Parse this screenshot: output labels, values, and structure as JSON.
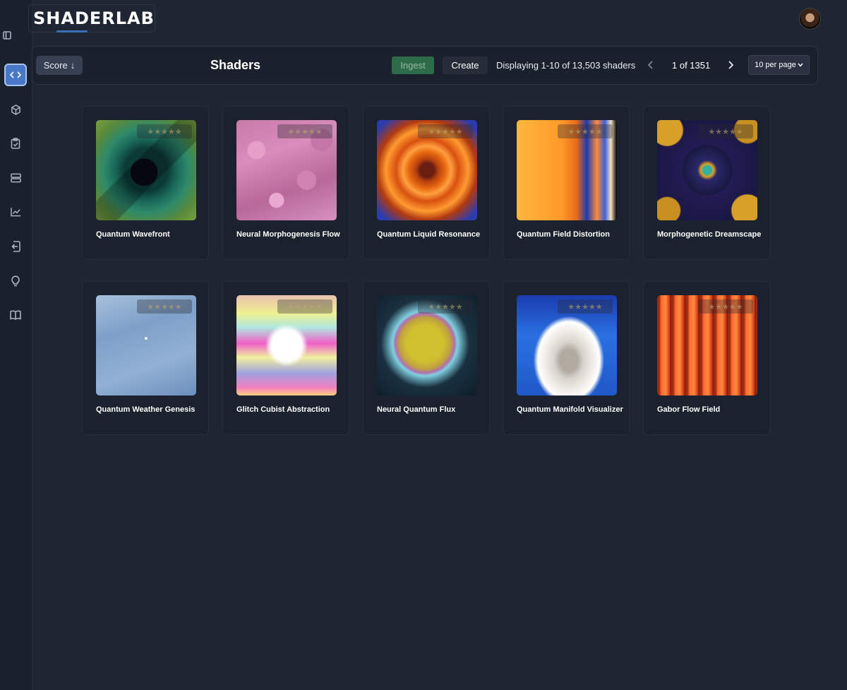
{
  "app": {
    "logo": "SHADERLAB"
  },
  "sidebar": {
    "toggle_icon": "sidebar-toggle-icon",
    "items": [
      {
        "name": "shaders",
        "icon": "code-icon",
        "active": true
      },
      {
        "name": "objects",
        "icon": "cube-icon",
        "active": false
      },
      {
        "name": "tasks",
        "icon": "clipboard-check-icon",
        "active": false
      },
      {
        "name": "storage",
        "icon": "server-icon",
        "active": false
      },
      {
        "name": "analytics",
        "icon": "line-chart-icon",
        "active": false
      },
      {
        "name": "import",
        "icon": "import-icon",
        "active": false
      },
      {
        "name": "ideas",
        "icon": "lightbulb-icon",
        "active": false
      },
      {
        "name": "docs",
        "icon": "book-icon",
        "active": false
      }
    ]
  },
  "toolbar": {
    "sort_label": "Score",
    "sort_arrow": "↓",
    "title": "Shaders",
    "ingest_label": "Ingest",
    "create_label": "Create",
    "display_text": "Displaying 1-10 of 13,503 shaders",
    "page_indicator": "1 of 1351",
    "per_page_label": "10 per page"
  },
  "rating_stars": "★★★★★",
  "shaders": [
    {
      "title": "Quantum Wavefront"
    },
    {
      "title": "Neural Morphogenesis Flow"
    },
    {
      "title": "Quantum Liquid Resonance"
    },
    {
      "title": "Quantum Field Distortion"
    },
    {
      "title": "Morphogenetic Dreamscape"
    },
    {
      "title": "Quantum Weather Genesis"
    },
    {
      "title": "Glitch Cubist Abstraction"
    },
    {
      "title": "Neural Quantum Flux"
    },
    {
      "title": "Quantum Manifold Visualizer"
    },
    {
      "title": "Gabor Flow Field"
    }
  ]
}
